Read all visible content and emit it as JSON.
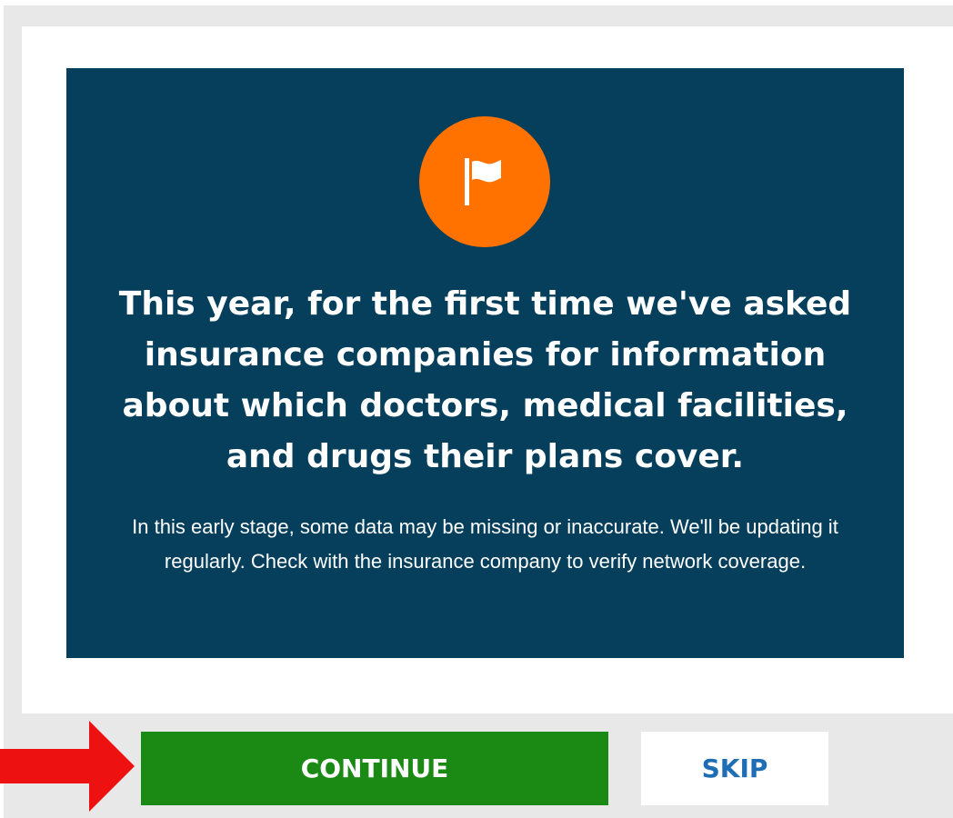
{
  "notice": {
    "headline": "This year, for the first time we've asked insurance companies for information about which doctors, medical facilities, and drugs their plans cover.",
    "body": "In this early stage, some data may be missing or inaccurate. We'll be updating it regularly. Check with the insurance company to verify network coverage.",
    "icon": "flag-icon"
  },
  "actions": {
    "continue_label": "CONTINUE",
    "skip_label": "SKIP"
  },
  "annotation": {
    "icon": "red-arrow-icon"
  },
  "colors": {
    "banner_background": "#063f5c",
    "icon_circle": "#ff7200",
    "continue_button": "#1a8a15",
    "skip_text": "#1f6eb5",
    "arrow": "#ee1111"
  }
}
